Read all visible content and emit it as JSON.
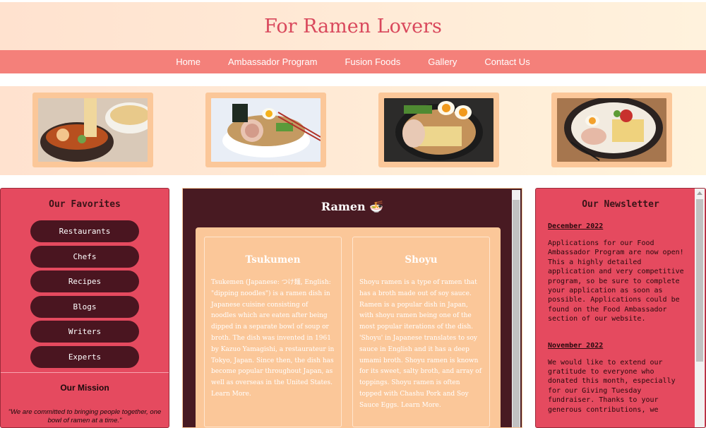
{
  "header": {
    "title": "For Ramen Lovers"
  },
  "nav": {
    "items": [
      "Home",
      "Ambassador Program",
      "Fusion Foods",
      "Gallery",
      "Contact Us"
    ]
  },
  "gallery": {
    "images": [
      "tsukemen-photo",
      "shoyu-ramen-photo",
      "ramen-bowl-photo",
      "tonkotsu-ramen-photo"
    ]
  },
  "favorites": {
    "heading": "Our Favorites",
    "buttons": [
      "Restaurants",
      "Chefs",
      "Recipes",
      "Blogs",
      "Writers",
      "Experts"
    ]
  },
  "mission": {
    "heading": "Our Mission",
    "text": "\"We are committed to bringing people together, one bowl of ramen at a time.\""
  },
  "main": {
    "title": "Ramen 🍜",
    "cards": [
      {
        "title": "Tsukumen",
        "text": "Tsukemen (Japanese: つけ麺, English: \"dipping noodles\") is a ramen dish in Japanese cuisine consisting of noodles which are eaten after being dipped in a separate bowl of soup or broth. The dish was invented in 1961 by Kazuo Yamagishi, a restaurateur in Tokyo, Japan. Since then, the dish has become popular throughout Japan, as well as overseas in the United States. Learn More."
      },
      {
        "title": "Shoyu",
        "text": "Shoyu ramen is a type of ramen that has a broth made out of soy sauce. Ramen is a popular dish in Japan, with shoyu ramen being one of the most popular iterations of the dish. 'Shoyu' in Japanese translates to soy sauce in English and it has a deep umami broth. Shoyu ramen is known for its sweet, salty broth, and array of toppings. Shoyu ramen is often topped with Chashu Pork and Soy Sauce Eggs. Learn More."
      }
    ]
  },
  "newsletter": {
    "heading": "Our Newsletter",
    "entries": [
      {
        "date": "December 2022",
        "text": "Applications for our Food Ambassador Program are now open! This a highly detailed application and very competitive program, so be sure to complete your application as soon as possible. Applications could be found on the Food Ambassador section of our website."
      },
      {
        "date": "November 2022",
        "text": "We would like to extend our gratitude to everyone who donated this month, especially for our Giving Tuesday fundraiser. Thanks to your generous contributions, we"
      }
    ]
  },
  "colors": {
    "accent": "#d9485c",
    "nav": "#f4807a",
    "panel": "#e54a5f",
    "dark": "#481a22",
    "peach": "#fbc799"
  }
}
